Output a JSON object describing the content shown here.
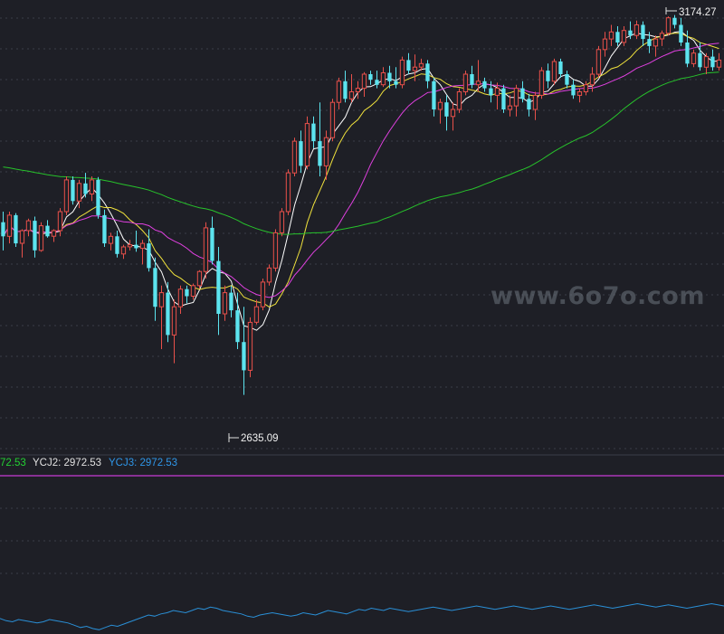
{
  "indicator_labels": {
    "ycj1": "72.53",
    "ycj2": "YCJ2: 2972.53",
    "ycj3": "YCJ3: 2972.53"
  },
  "annotations": {
    "high": "3174.27",
    "low": "2635.09"
  },
  "watermark": "www.6o7o.com",
  "colors": {
    "background": "#1e1f26",
    "grid": "#3a3d48",
    "up": "#e8504a",
    "down": "#5ce4ef",
    "ma_fast": "#ffffff",
    "ma_mid": "#f0e23c",
    "ma_slow": "#e040e0",
    "ma_long": "#27c22b",
    "indicator_line": "#2a8fd6",
    "ycj1": "#23d033",
    "ycj2": "#e0e0e0",
    "ycj3": "#2f96e8",
    "ycj_hline": "#c83ad6"
  },
  "chart_data": {
    "type": "candlestick",
    "title": "",
    "candles_ohlc": [
      [
        2880,
        2895,
        2840,
        2860
      ],
      [
        2860,
        2895,
        2850,
        2890
      ],
      [
        2890,
        2893,
        2845,
        2850
      ],
      [
        2850,
        2870,
        2830,
        2868
      ],
      [
        2868,
        2885,
        2860,
        2882
      ],
      [
        2882,
        2888,
        2830,
        2840
      ],
      [
        2840,
        2880,
        2838,
        2875
      ],
      [
        2875,
        2883,
        2858,
        2860
      ],
      [
        2860,
        2870,
        2852,
        2868
      ],
      [
        2868,
        2900,
        2860,
        2895
      ],
      [
        2895,
        2945,
        2890,
        2940
      ],
      [
        2940,
        2945,
        2905,
        2910
      ],
      [
        2910,
        2940,
        2900,
        2935
      ],
      [
        2935,
        2950,
        2915,
        2920
      ],
      [
        2920,
        2945,
        2910,
        2940
      ],
      [
        2940,
        2944,
        2885,
        2890
      ],
      [
        2890,
        2898,
        2845,
        2850
      ],
      [
        2850,
        2865,
        2840,
        2860
      ],
      [
        2860,
        2868,
        2830,
        2835
      ],
      [
        2835,
        2848,
        2828,
        2845
      ],
      [
        2845,
        2855,
        2840,
        2848
      ],
      [
        2848,
        2868,
        2838,
        2843
      ],
      [
        2843,
        2855,
        2820,
        2850
      ],
      [
        2850,
        2870,
        2810,
        2815
      ],
      [
        2815,
        2830,
        2740,
        2760
      ],
      [
        2760,
        2790,
        2700,
        2780
      ],
      [
        2780,
        2795,
        2710,
        2720
      ],
      [
        2720,
        2770,
        2680,
        2760
      ],
      [
        2760,
        2790,
        2750,
        2785
      ],
      [
        2785,
        2790,
        2765,
        2775
      ],
      [
        2775,
        2793,
        2770,
        2790
      ],
      [
        2790,
        2812,
        2786,
        2810
      ],
      [
        2810,
        2880,
        2800,
        2872
      ],
      [
        2872,
        2888,
        2820,
        2825
      ],
      [
        2825,
        2845,
        2720,
        2750
      ],
      [
        2750,
        2790,
        2740,
        2780
      ],
      [
        2780,
        2790,
        2745,
        2755
      ],
      [
        2755,
        2780,
        2700,
        2710
      ],
      [
        2710,
        2760,
        2635,
        2670
      ],
      [
        2670,
        2745,
        2660,
        2738
      ],
      [
        2738,
        2770,
        2735,
        2760
      ],
      [
        2760,
        2800,
        2755,
        2795
      ],
      [
        2795,
        2820,
        2790,
        2815
      ],
      [
        2815,
        2870,
        2810,
        2865
      ],
      [
        2865,
        2900,
        2860,
        2895
      ],
      [
        2895,
        2955,
        2890,
        2950
      ],
      [
        2950,
        3000,
        2945,
        2995
      ],
      [
        2995,
        3010,
        2950,
        2960
      ],
      [
        2960,
        3030,
        2955,
        3020
      ],
      [
        3020,
        3030,
        2985,
        2995
      ],
      [
        2995,
        3050,
        2945,
        2960
      ],
      [
        2960,
        3010,
        2940,
        3000
      ],
      [
        3000,
        3055,
        2995,
        3050
      ],
      [
        3050,
        3085,
        3040,
        3080
      ],
      [
        3080,
        3095,
        3050,
        3055
      ],
      [
        3055,
        3090,
        3050,
        3065
      ],
      [
        3065,
        3080,
        3055,
        3070
      ],
      [
        3070,
        3093,
        3058,
        3090
      ],
      [
        3090,
        3095,
        3075,
        3082
      ],
      [
        3082,
        3095,
        3070,
        3075
      ],
      [
        3075,
        3100,
        3072,
        3092
      ],
      [
        3092,
        3102,
        3070,
        3080
      ],
      [
        3080,
        3100,
        3070,
        3075
      ],
      [
        3075,
        3115,
        3070,
        3110
      ],
      [
        3110,
        3120,
        3090,
        3095
      ],
      [
        3095,
        3118,
        3080,
        3100
      ],
      [
        3100,
        3112,
        3095,
        3105
      ],
      [
        3105,
        3110,
        3070,
        3080
      ],
      [
        3080,
        3085,
        3030,
        3040
      ],
      [
        3040,
        3055,
        3020,
        3050
      ],
      [
        3050,
        3060,
        3010,
        3030
      ],
      [
        3030,
        3050,
        3010,
        3040
      ],
      [
        3040,
        3070,
        3035,
        3065
      ],
      [
        3065,
        3095,
        3060,
        3090
      ],
      [
        3090,
        3102,
        3070,
        3075
      ],
      [
        3075,
        3110,
        3065,
        3080
      ],
      [
        3080,
        3085,
        3065,
        3070
      ],
      [
        3070,
        3080,
        3050,
        3060
      ],
      [
        3060,
        3078,
        3040,
        3070
      ],
      [
        3070,
        3075,
        3035,
        3040
      ],
      [
        3040,
        3060,
        3030,
        3045
      ],
      [
        3045,
        3075,
        3030,
        3070
      ],
      [
        3070,
        3080,
        3050,
        3055
      ],
      [
        3055,
        3062,
        3030,
        3040
      ],
      [
        3040,
        3065,
        3025,
        3060
      ],
      [
        3060,
        3100,
        3055,
        3095
      ],
      [
        3095,
        3105,
        3070,
        3080
      ],
      [
        3080,
        3112,
        3075,
        3108
      ],
      [
        3108,
        3112,
        3085,
        3090
      ],
      [
        3090,
        3095,
        3070,
        3075
      ],
      [
        3075,
        3082,
        3055,
        3060
      ],
      [
        3060,
        3070,
        3050,
        3065
      ],
      [
        3065,
        3080,
        3060,
        3075
      ],
      [
        3075,
        3100,
        3065,
        3090
      ],
      [
        3090,
        3130,
        3085,
        3125
      ],
      [
        3125,
        3150,
        3115,
        3140
      ],
      [
        3140,
        3160,
        3130,
        3150
      ],
      [
        3150,
        3158,
        3130,
        3135
      ],
      [
        3135,
        3158,
        3130,
        3152
      ],
      [
        3152,
        3165,
        3140,
        3145
      ],
      [
        3145,
        3166,
        3140,
        3160
      ],
      [
        3160,
        3165,
        3130,
        3140
      ],
      [
        3140,
        3150,
        3120,
        3130
      ],
      [
        3130,
        3145,
        3115,
        3140
      ],
      [
        3140,
        3152,
        3130,
        3148
      ],
      [
        3148,
        3172,
        3145,
        3170
      ],
      [
        3170,
        3174,
        3155,
        3160
      ],
      [
        3160,
        3170,
        3130,
        3135
      ],
      [
        3135,
        3152,
        3100,
        3105
      ],
      [
        3105,
        3125,
        3100,
        3120
      ],
      [
        3120,
        3135,
        3095,
        3100
      ],
      [
        3100,
        3120,
        3090,
        3115
      ],
      [
        3115,
        3125,
        3095,
        3100
      ],
      [
        3100,
        3120,
        3095,
        3110
      ]
    ],
    "moving_averages": [
      {
        "period": 5,
        "color": "#ffffff"
      },
      {
        "period": 10,
        "color": "#f0e23c"
      },
      {
        "period": 20,
        "color": "#e040e0"
      },
      {
        "period": 60,
        "color": "#27c22b",
        "seed": 2960
      }
    ],
    "price_axis": {
      "max": 3185,
      "min": 2605
    },
    "marked_high": 3174.27,
    "marked_low": 2635.09,
    "grid": true,
    "indicator_panel": {
      "ycj1": 2972.53,
      "ycj2": 2972.53,
      "ycj3": 2972.53,
      "oscillator_line": [
        53,
        51,
        50,
        52,
        51,
        50,
        49,
        50,
        52,
        51,
        50,
        49,
        47,
        45,
        46,
        44,
        43,
        45,
        47,
        46,
        48,
        50,
        52,
        54,
        56,
        55,
        57,
        58,
        60,
        59,
        58,
        60,
        62,
        61,
        63,
        62,
        60,
        59,
        58,
        57,
        55,
        54,
        56,
        57,
        58,
        57,
        56,
        55,
        56,
        58,
        57,
        56,
        58,
        60,
        59,
        58,
        57,
        59,
        61,
        60,
        62,
        61,
        60,
        62,
        61,
        60,
        59,
        60,
        61,
        62,
        63,
        62,
        61,
        60,
        61,
        62,
        63,
        64,
        63,
        62,
        61,
        62,
        63,
        64,
        63,
        62,
        61,
        62,
        63,
        64,
        63,
        62,
        61,
        62,
        63,
        64,
        65,
        64,
        63,
        62,
        63,
        64,
        65,
        66,
        65,
        64,
        63,
        64,
        65,
        64,
        63,
        62,
        63,
        64,
        65,
        66,
        65,
        64
      ],
      "oscillator_range": [
        0,
        100
      ]
    }
  }
}
